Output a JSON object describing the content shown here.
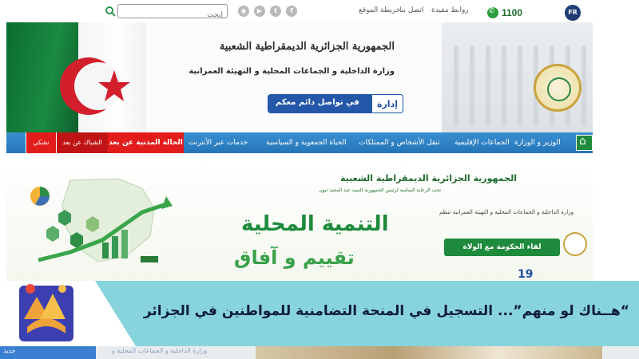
{
  "topbar": {
    "lang_badge": "FR",
    "phone": "1100",
    "links": [
      "روابط مفيدة",
      "اتصل بنا",
      "خريطة الموقع"
    ],
    "social_icons": [
      "facebook-icon",
      "twitter-icon",
      "youtube-icon",
      "rss-icon"
    ],
    "search_placeholder": "إبحث"
  },
  "header": {
    "title_line_1": "الجمهورية الجزائرية الديمقراطية الشعبية",
    "title_line_2": "وزارة الداخلية و الجماعات المحلية و التهيئة العمرانية",
    "idara_tag": "إدارة",
    "idara_text": "في تواصل دائم معكم"
  },
  "nav": {
    "items": [
      "الوزير و الوزارة",
      "الجماعات الإقليمية",
      "تنقل الأشخاص و الممتلكات",
      "الحياة الجمعوية و السياسية",
      "خدمات عبر الأنترنت"
    ],
    "red_1": "الحالة المدنية عن بعد",
    "red_2": "الشباك عن بعد",
    "red_3": "نشكي"
  },
  "hero": {
    "title_1": "الجمهورية الجزائرية الديمقراطية الشعبية",
    "title_2": "تحت الرعاية السامية لرئيس الجمهورية السيد عبد المجيد تبون",
    "ministry": "وزارة الداخلية و الجماعات المحلية و التهيئة العمرانية تنظم",
    "big_1": "التنمية المحلية",
    "big_2": "تقييم و آفاق",
    "meeting": "لقاء الحكومة مع الولاة",
    "date_fragment": "19"
  },
  "overlay": {
    "headline": "“هــناك لو منهم”... التسجيل في المنحة التضامنية للمواطنين في الجزائر"
  },
  "peek": {
    "new_label": "جديد",
    "text": "وزارة الداخلية و الجماعات المحلية و"
  },
  "colors": {
    "nav_blue": "#2474b8",
    "nav_red": "#e21b1b",
    "overlay_cyan": "#88d4dc",
    "green": "#1e8a3c"
  }
}
